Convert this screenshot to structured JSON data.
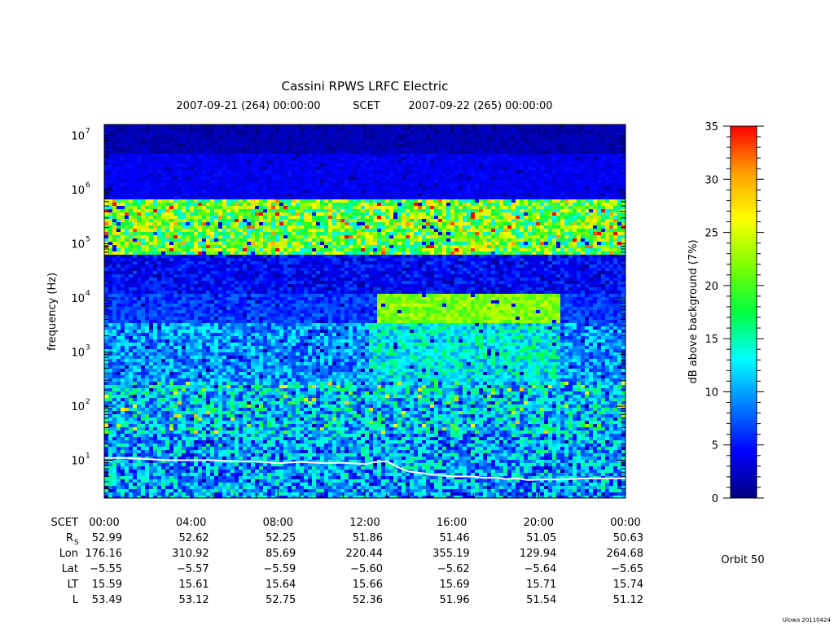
{
  "chart_data": {
    "type": "heatmap",
    "title": "Cassini RPWS LRFC Electric",
    "subtitle": {
      "start": "2007-09-21 (264) 00:00:00",
      "scet": "SCET",
      "end": "2007-09-22 (265) 00:00:00"
    },
    "ylabel": "frequency (Hz)",
    "y_scale": "log",
    "ylim": [
      2,
      16000000
    ],
    "y_ticks": [
      {
        "base": "10",
        "exp": "1",
        "value": 10
      },
      {
        "base": "10",
        "exp": "2",
        "value": 100
      },
      {
        "base": "10",
        "exp": "3",
        "value": 1000
      },
      {
        "base": "10",
        "exp": "4",
        "value": 10000
      },
      {
        "base": "10",
        "exp": "5",
        "value": 100000
      },
      {
        "base": "10",
        "exp": "6",
        "value": 1000000
      },
      {
        "base": "10",
        "exp": "7",
        "value": 10000000
      }
    ],
    "xlim_hours": [
      0,
      24
    ],
    "x_ticks": [
      "00:00",
      "04:00",
      "08:00",
      "12:00",
      "16:00",
      "20:00",
      "00:00"
    ],
    "colorbar": {
      "label": "dB above background (7%)",
      "range": [
        0,
        35
      ],
      "ticks": [
        "0",
        "5",
        "10",
        "15",
        "20",
        "25",
        "30",
        "35"
      ],
      "colors": [
        "#000080",
        "#0000ff",
        "#0080ff",
        "#00ffff",
        "#00ff40",
        "#80ff00",
        "#ffff00",
        "#ffa000",
        "#ff0000"
      ]
    },
    "series": [
      {
        "color": "#ffffff",
        "x_hours": [
          0,
          1,
          2,
          3,
          4,
          5,
          6,
          7,
          8,
          9,
          10,
          11,
          12,
          12.5,
          13,
          13.5,
          14,
          15,
          16,
          17,
          17.5,
          18,
          18.5,
          19,
          19.5,
          20,
          21,
          22,
          23,
          24
        ],
        "y_hz": [
          11,
          11,
          10.5,
          10,
          10,
          10,
          9.5,
          9.5,
          8.8,
          9.3,
          8.9,
          9,
          8.5,
          9.3,
          9.6,
          7.5,
          6.2,
          5.5,
          5,
          5,
          4.7,
          4.8,
          4.5,
          4.6,
          4.3,
          4.4,
          4.4,
          4.6,
          4.6,
          4.6
        ]
      }
    ],
    "ephemeris": {
      "rows": [
        {
          "label": "SCET",
          "sub": "",
          "values": [
            "00:00",
            "04:00",
            "08:00",
            "12:00",
            "16:00",
            "20:00",
            "00:00"
          ]
        },
        {
          "label": "R",
          "sub": "S",
          "values": [
            "52.99",
            "52.62",
            "52.25",
            "51.86",
            "51.46",
            "51.05",
            "50.63"
          ]
        },
        {
          "label": "Lon",
          "sub": "",
          "values": [
            "176.16",
            "310.92",
            "85.69",
            "220.44",
            "355.19",
            "129.94",
            "264.68"
          ]
        },
        {
          "label": "Lat",
          "sub": "",
          "values": [
            "−5.55",
            "−5.57",
            "−5.59",
            "−5.60",
            "−5.62",
            "−5.64",
            "−5.65"
          ]
        },
        {
          "label": "LT",
          "sub": "",
          "values": [
            "15.59",
            "15.61",
            "15.64",
            "15.66",
            "15.69",
            "15.71",
            "15.74"
          ]
        },
        {
          "label": "L",
          "sub": "",
          "values": [
            "53.49",
            "53.12",
            "52.75",
            "52.36",
            "51.96",
            "51.54",
            "51.12"
          ]
        }
      ]
    }
  },
  "orbit_label": "Orbit 50",
  "footer_stamp": "Ulowa 20110424"
}
